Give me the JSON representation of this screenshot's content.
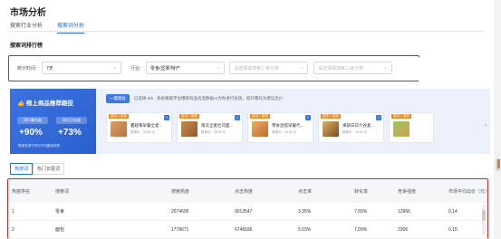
{
  "page": {
    "title": "市场分析"
  },
  "tabs": [
    {
      "label": "搜索行业分析"
    },
    {
      "label": "搜索词分析"
    }
  ],
  "section_title": "搜索词排行榜",
  "filters": {
    "period_label": "统计时间:",
    "period_value": "7天",
    "industry_label": "行业:",
    "industry_value": "零食/坚果/特产",
    "level2_placeholder": "请选择或搜索二级分类",
    "level3_placeholder": "请选择或搜索三级分类"
  },
  "banner": {
    "card_title": "榜上商品推荐跟投",
    "pill_left": "同行曝光量",
    "pill_right": "同行点击量",
    "pct_left": "+90%",
    "pct_right": "+73%",
    "note": "*数据来源于同行平均跟投效果",
    "one_key_label": "一键跟投",
    "selected_text": "已选择 5/6 · 系统根据平台爆款商品优选数据AI为你进行投放，提升曝光为建议出价",
    "products": [
      {
        "tag": "搜词 1 推荐",
        "name": "蔓越莓早餐全麦...",
        "sub": "推荐价：26.80 元"
      },
      {
        "tag": "搜词 1 推荐",
        "name": "南瓜全麦吐司面...",
        "sub": "推荐价：26.80 元"
      },
      {
        "tag": "搜词 1 推荐",
        "name": "零食混搭早餐代...",
        "sub": "推荐价：16.80 元"
      },
      {
        "tag": "搜词 1 推荐",
        "name": "果蔬日日汁谷麦...",
        "sub": "推荐价：16.80 元"
      },
      {
        "tag": "搜词 1 推荐",
        "name": "",
        "sub": ""
      }
    ]
  },
  "sub_tabs": [
    {
      "label": "热搜词"
    },
    {
      "label": "热门长尾词"
    }
  ],
  "table": {
    "headers": [
      "热度排名",
      "搜索词",
      "搜索热度",
      "点击热度",
      "点击率",
      "转化率",
      "竞争强度",
      "市场平均出价（元）"
    ],
    "rows": [
      [
        "1",
        "零食",
        "2674695",
        "9013547",
        "3.35%",
        "7.55%",
        "12966",
        "0.14"
      ],
      [
        "2",
        "面包",
        "1778671",
        "6748186",
        "5.03%",
        "7.09%",
        "2306",
        "0.15"
      ]
    ]
  },
  "colors": {
    "accent": "#1f6fe0",
    "highlight_box": "#e02020",
    "tag": "#f08a24"
  }
}
